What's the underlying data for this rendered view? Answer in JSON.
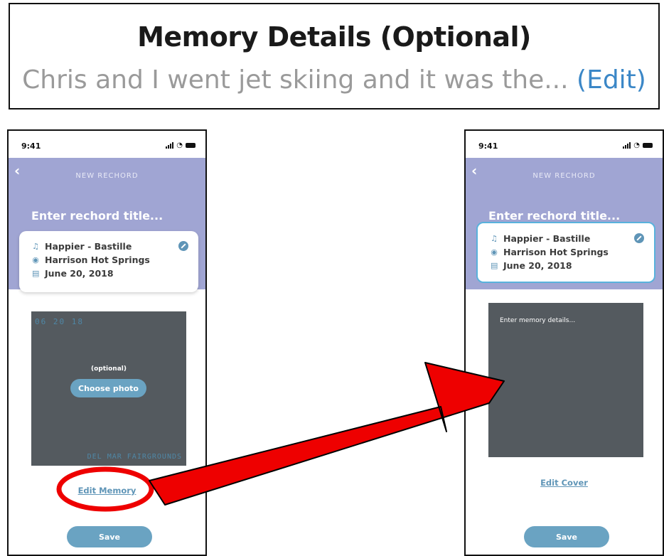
{
  "callout": {
    "title": "Memory Details (Optional)",
    "body": "Chris and I went jet skiing and it was the...",
    "edit_label": "(Edit)"
  },
  "colors": {
    "header": "#a0a5d3",
    "accent": "#6aa3c2",
    "cover_bg": "#545a5f",
    "annotation": "#ee0000"
  },
  "left_phone": {
    "time": "9:41",
    "nav_title": "NEW RECHORD",
    "title_placeholder": "Enter rechord title...",
    "card": {
      "song": "Happier - Bastille",
      "location": "Harrison Hot Springs",
      "date": "June 20, 2018"
    },
    "cover": {
      "date_stamp": "06 20 18",
      "optional_label": "(optional)",
      "choose_photo_label": "Choose photo",
      "location_stamp": "DEL MAR FAIRGROUNDS"
    },
    "edit_memory_label": "Edit Memory",
    "save_label": "Save"
  },
  "right_phone": {
    "time": "9:41",
    "nav_title": "NEW RECHORD",
    "title_placeholder": "Enter rechord title...",
    "card": {
      "song": "Happier - Bastille",
      "location": "Harrison Hot Springs",
      "date": "June 20, 2018"
    },
    "memory_placeholder": "Enter memory details...",
    "edit_cover_label": "Edit Cover",
    "save_label": "Save"
  },
  "icons": [
    "music-note-icon",
    "location-pin-icon",
    "calendar-icon",
    "edit-pencil-icon",
    "back-chevron-icon",
    "signal-icon",
    "wifi-icon",
    "battery-icon"
  ]
}
